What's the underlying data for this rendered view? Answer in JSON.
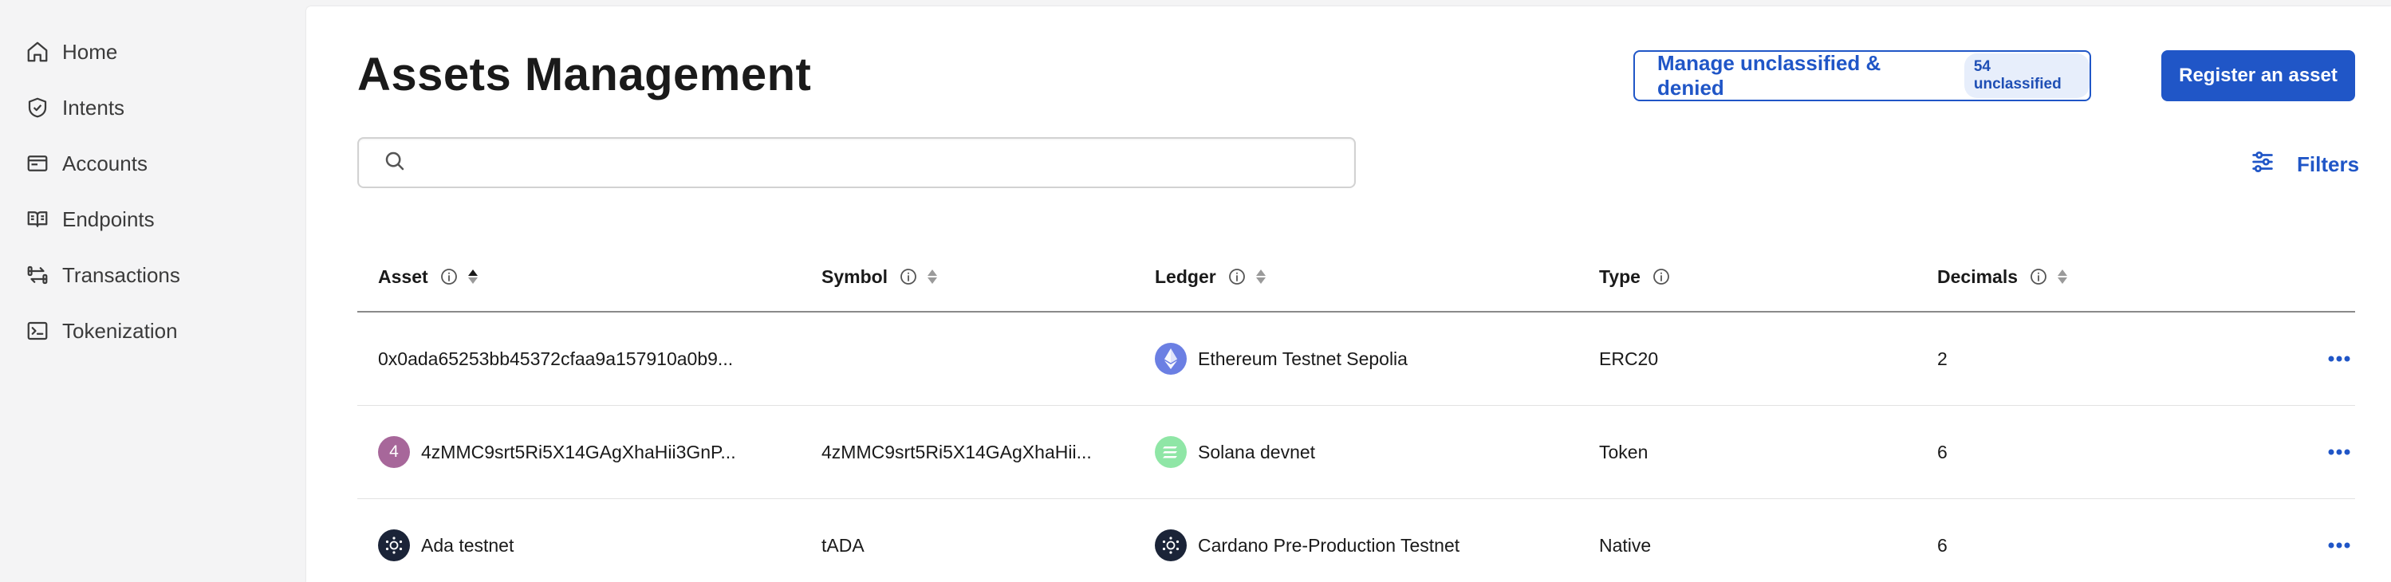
{
  "sidebar": {
    "items": [
      {
        "label": "Home",
        "icon": "home-icon"
      },
      {
        "label": "Intents",
        "icon": "shield-check-icon"
      },
      {
        "label": "Accounts",
        "icon": "wallet-icon"
      },
      {
        "label": "Endpoints",
        "icon": "book-icon"
      },
      {
        "label": "Transactions",
        "icon": "transfer-icon"
      },
      {
        "label": "Tokenization",
        "icon": "terminal-icon"
      }
    ]
  },
  "page": {
    "title": "Assets Management"
  },
  "header": {
    "manage_label": "Manage unclassified & denied",
    "unclassified_badge": "54 unclassified",
    "register_label": "Register an asset",
    "filters_label": "Filters"
  },
  "search": {
    "placeholder": "",
    "value": ""
  },
  "table": {
    "columns": [
      "Asset",
      "Symbol",
      "Ledger",
      "Type",
      "Decimals"
    ],
    "rows": [
      {
        "asset": "0x0ada65253bb45372cfaa9a157910a0b9...",
        "asset_icon": "none",
        "symbol": "",
        "ledger": "Ethereum Testnet Sepolia",
        "ledger_icon": "ethereum-icon",
        "type": "ERC20",
        "decimals": "2"
      },
      {
        "asset": "4zMMC9srt5Ri5X14GAgXhaHii3GnP...",
        "asset_icon": "letter-4",
        "asset_letter": "4",
        "symbol": "4zMMC9srt5Ri5X14GAgXhaHii...",
        "ledger": "Solana devnet",
        "ledger_icon": "solana-icon",
        "type": "Token",
        "decimals": "6"
      },
      {
        "asset": "Ada testnet",
        "asset_icon": "cardano-icon",
        "symbol": "tADA",
        "ledger": "Cardano Pre-Production Testnet",
        "ledger_icon": "cardano-icon",
        "type": "Native",
        "decimals": "6"
      }
    ]
  },
  "colors": {
    "accent": "#2056c7",
    "ethereum": "#6b7fe3",
    "solana": "#8fe6a6",
    "cardano": "#1b2438",
    "letter_avatar": "#a7679a"
  }
}
